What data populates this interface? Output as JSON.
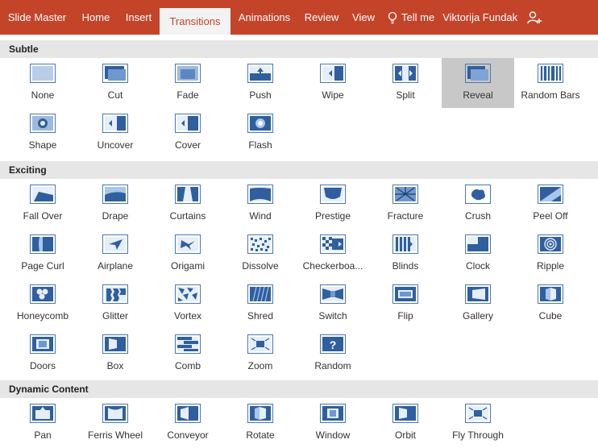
{
  "ribbon": {
    "tabs": [
      {
        "label": "Slide Master",
        "active": false
      },
      {
        "label": "Home",
        "active": false
      },
      {
        "label": "Insert",
        "active": false
      },
      {
        "label": "Transitions",
        "active": true
      },
      {
        "label": "Animations",
        "active": false
      },
      {
        "label": "Review",
        "active": false
      },
      {
        "label": "View",
        "active": false
      }
    ],
    "tell_me": "Tell me",
    "user": "Viktorija Fundak",
    "accent": "#c4442a"
  },
  "sections": [
    {
      "title": "Subtle",
      "items": [
        {
          "label": "None",
          "icon": "none-transition-icon"
        },
        {
          "label": "Cut",
          "icon": "cut-transition-icon"
        },
        {
          "label": "Fade",
          "icon": "fade-transition-icon"
        },
        {
          "label": "Push",
          "icon": "push-transition-icon"
        },
        {
          "label": "Wipe",
          "icon": "wipe-transition-icon"
        },
        {
          "label": "Split",
          "icon": "split-transition-icon"
        },
        {
          "label": "Reveal",
          "icon": "reveal-transition-icon",
          "selected": true
        },
        {
          "label": "Random Bars",
          "icon": "random-bars-transition-icon"
        },
        {
          "label": "Shape",
          "icon": "shape-transition-icon"
        },
        {
          "label": "Uncover",
          "icon": "uncover-transition-icon"
        },
        {
          "label": "Cover",
          "icon": "cover-transition-icon"
        },
        {
          "label": "Flash",
          "icon": "flash-transition-icon"
        }
      ]
    },
    {
      "title": "Exciting",
      "items": [
        {
          "label": "Fall Over",
          "icon": "fall-over-transition-icon"
        },
        {
          "label": "Drape",
          "icon": "drape-transition-icon"
        },
        {
          "label": "Curtains",
          "icon": "curtains-transition-icon"
        },
        {
          "label": "Wind",
          "icon": "wind-transition-icon"
        },
        {
          "label": "Prestige",
          "icon": "prestige-transition-icon"
        },
        {
          "label": "Fracture",
          "icon": "fracture-transition-icon"
        },
        {
          "label": "Crush",
          "icon": "crush-transition-icon"
        },
        {
          "label": "Peel Off",
          "icon": "peel-off-transition-icon"
        },
        {
          "label": "Page Curl",
          "icon": "page-curl-transition-icon"
        },
        {
          "label": "Airplane",
          "icon": "airplane-transition-icon"
        },
        {
          "label": "Origami",
          "icon": "origami-transition-icon"
        },
        {
          "label": "Dissolve",
          "icon": "dissolve-transition-icon"
        },
        {
          "label": "Checkerboa...",
          "icon": "checkerboard-transition-icon"
        },
        {
          "label": "Blinds",
          "icon": "blinds-transition-icon"
        },
        {
          "label": "Clock",
          "icon": "clock-transition-icon"
        },
        {
          "label": "Ripple",
          "icon": "ripple-transition-icon"
        },
        {
          "label": "Honeycomb",
          "icon": "honeycomb-transition-icon"
        },
        {
          "label": "Glitter",
          "icon": "glitter-transition-icon"
        },
        {
          "label": "Vortex",
          "icon": "vortex-transition-icon"
        },
        {
          "label": "Shred",
          "icon": "shred-transition-icon"
        },
        {
          "label": "Switch",
          "icon": "switch-transition-icon"
        },
        {
          "label": "Flip",
          "icon": "flip-transition-icon"
        },
        {
          "label": "Gallery",
          "icon": "gallery-transition-icon"
        },
        {
          "label": "Cube",
          "icon": "cube-transition-icon"
        },
        {
          "label": "Doors",
          "icon": "doors-transition-icon"
        },
        {
          "label": "Box",
          "icon": "box-transition-icon"
        },
        {
          "label": "Comb",
          "icon": "comb-transition-icon"
        },
        {
          "label": "Zoom",
          "icon": "zoom-transition-icon"
        },
        {
          "label": "Random",
          "icon": "random-transition-icon"
        }
      ]
    },
    {
      "title": "Dynamic Content",
      "items": [
        {
          "label": "Pan",
          "icon": "pan-transition-icon"
        },
        {
          "label": "Ferris Wheel",
          "icon": "ferris-wheel-transition-icon"
        },
        {
          "label": "Conveyor",
          "icon": "conveyor-transition-icon"
        },
        {
          "label": "Rotate",
          "icon": "rotate-transition-icon"
        },
        {
          "label": "Window",
          "icon": "window-transition-icon"
        },
        {
          "label": "Orbit",
          "icon": "orbit-transition-icon"
        },
        {
          "label": "Fly Through",
          "icon": "fly-through-transition-icon"
        }
      ]
    }
  ]
}
